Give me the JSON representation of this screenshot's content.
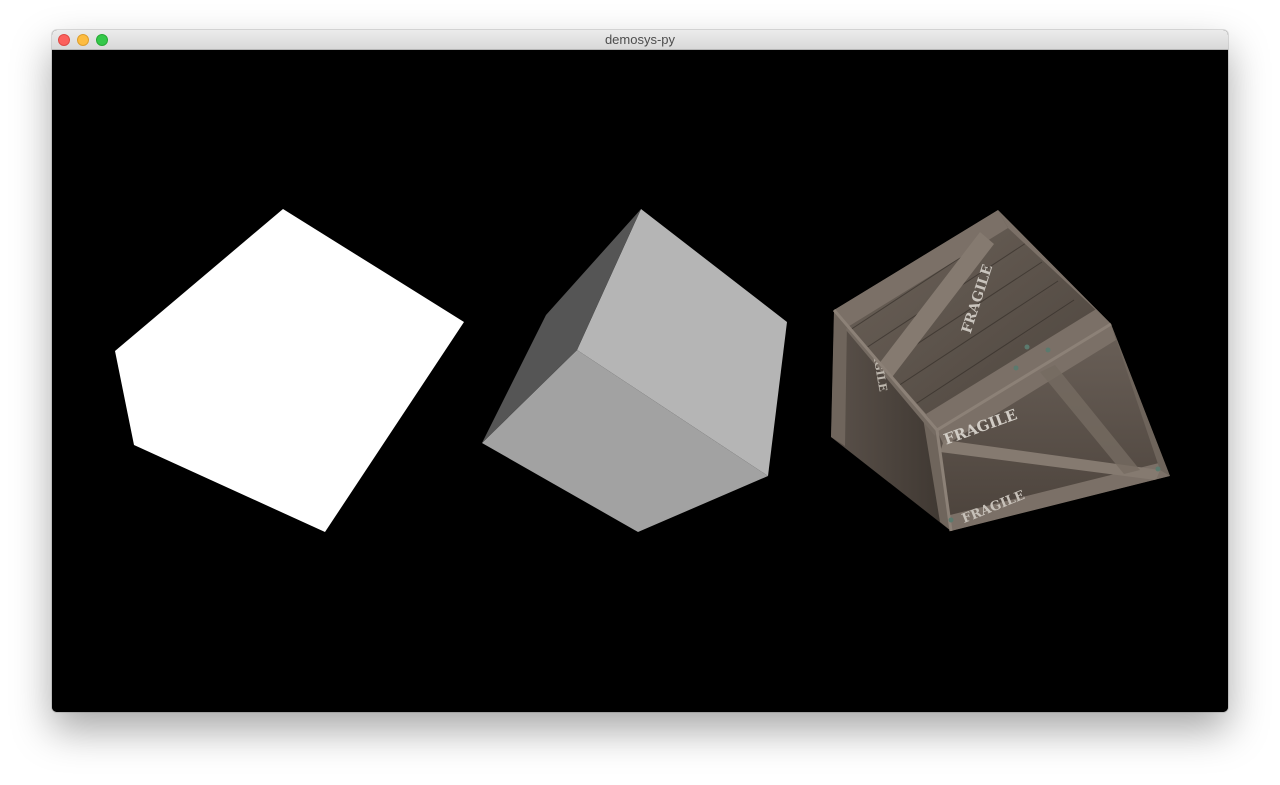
{
  "window": {
    "title": "demosys-py"
  },
  "colors": {
    "background": "#000000",
    "flat_cube": "#ffffff",
    "shaded_cube_top": "#b5b5b5",
    "shaded_cube_front": "#a0a0a0",
    "shaded_cube_left": "#555555",
    "crate_wood_light": "#7a6f65",
    "crate_wood_dark": "#3f3731"
  },
  "crate": {
    "stencil_text": "FRAGILE"
  },
  "icons": [
    "close-button-icon",
    "minimize-button-icon",
    "maximize-button-icon"
  ]
}
